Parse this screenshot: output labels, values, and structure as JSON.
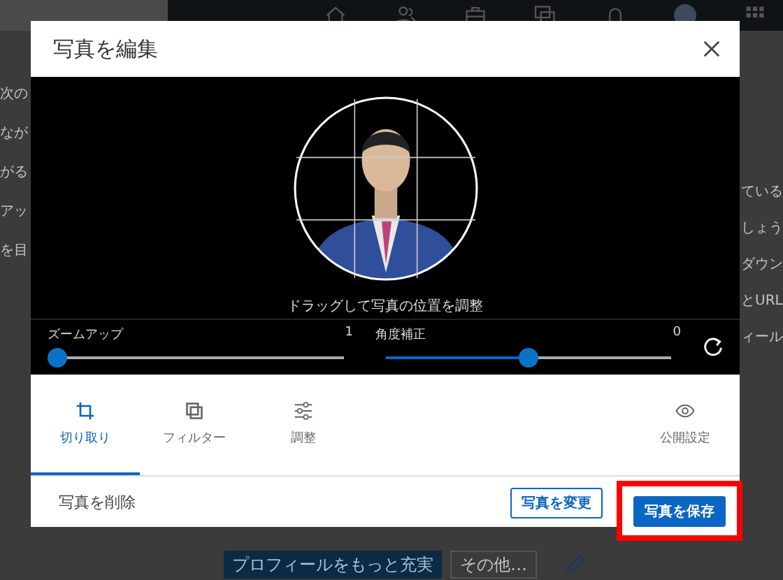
{
  "background": {
    "left_fragments": [
      "次の",
      "なが",
      "がる",
      "アッ",
      "を目"
    ],
    "right_fragments": [
      "ている",
      "しょう",
      "ダウン",
      "とURL",
      "ィール"
    ],
    "profile_button": "プロフィールをもっと充実",
    "more_button": "その他…"
  },
  "dialog": {
    "title": "写真を編集",
    "caption": "ドラッグして写真の位置を調整",
    "sliders": [
      {
        "label": "ズームアップ",
        "reading": "1",
        "level": 0
      },
      {
        "label": "角度補正",
        "reading": "0",
        "level": 0.5
      }
    ],
    "tabs": [
      {
        "label": "切り取り",
        "kind": "crop",
        "selected": true
      },
      {
        "label": "フィルター",
        "kind": "filter",
        "selected": false
      },
      {
        "label": "調整",
        "kind": "adjust",
        "selected": false
      }
    ],
    "visibility": {
      "label": "公開設定"
    },
    "delete_link": "写真を削除",
    "buttons": [
      {
        "label": "写真を変更",
        "kind": "secondary",
        "highlighted": false
      },
      {
        "label": "写真を保存",
        "kind": "primary",
        "highlighted": true
      }
    ]
  }
}
